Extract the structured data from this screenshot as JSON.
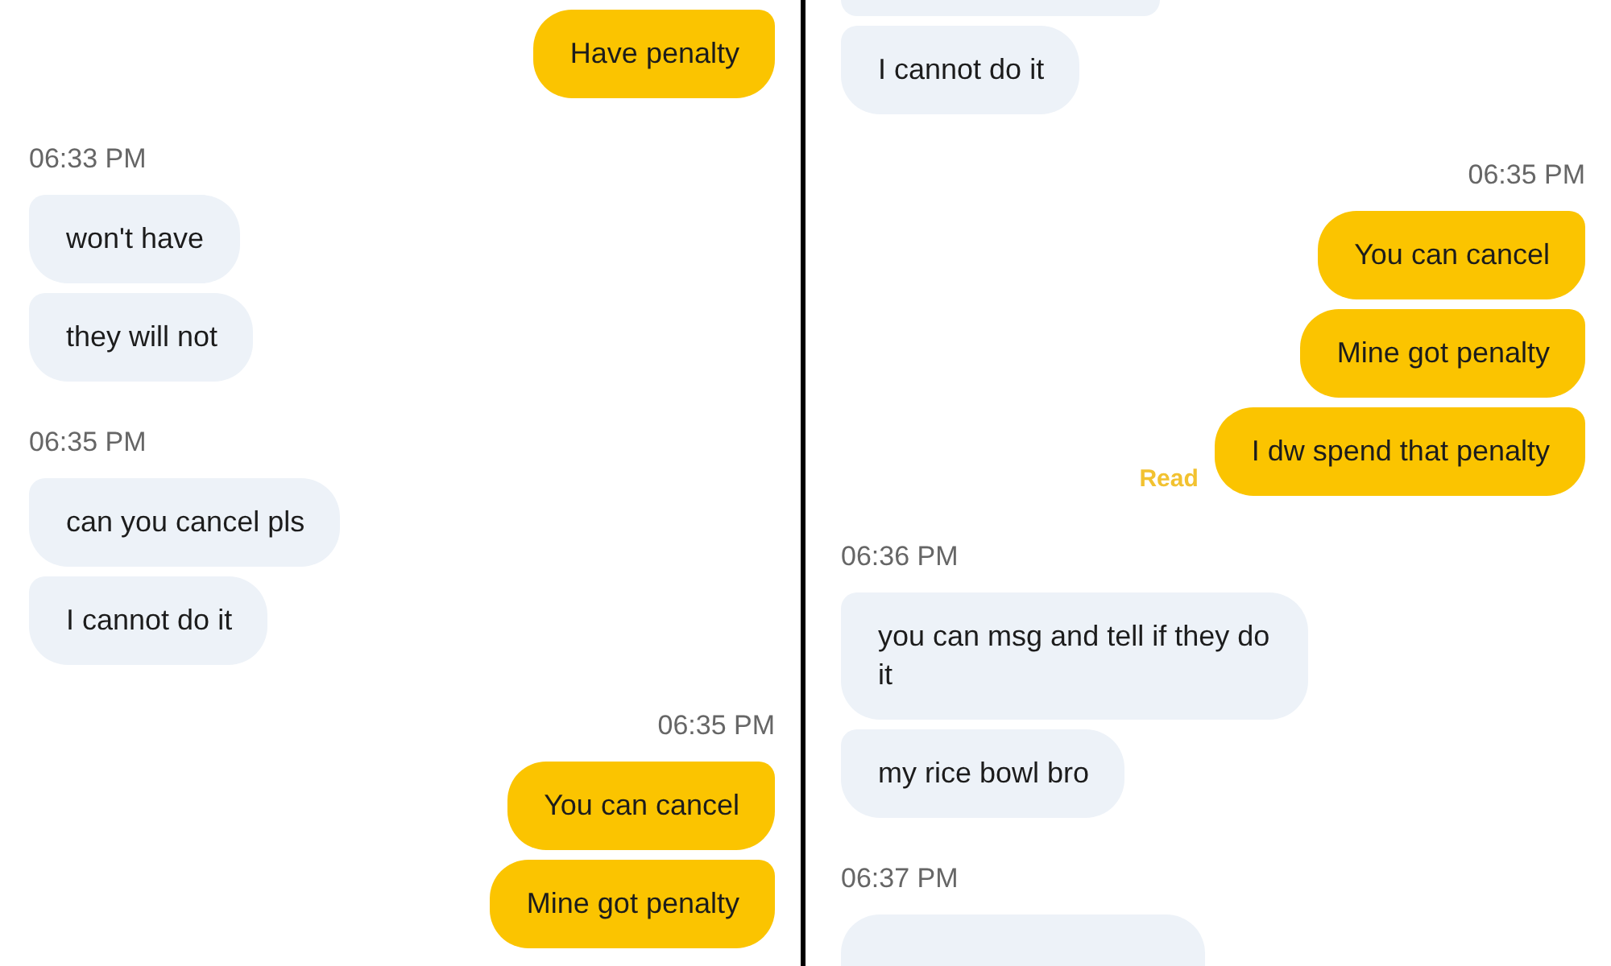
{
  "panels": [
    {
      "items": [
        {
          "kind": "out",
          "text": "Have penalty"
        },
        {
          "kind": "time-left",
          "text": "06:33 PM"
        },
        {
          "kind": "in",
          "text": "won't have"
        },
        {
          "kind": "in",
          "text": "they will not"
        },
        {
          "kind": "time-left",
          "text": "06:35 PM"
        },
        {
          "kind": "in",
          "text": "can you cancel pls"
        },
        {
          "kind": "in",
          "text": "I cannot do it"
        },
        {
          "kind": "time-right",
          "text": "06:35 PM"
        },
        {
          "kind": "out",
          "text": "You can cancel"
        },
        {
          "kind": "out",
          "text": "Mine got penalty"
        }
      ]
    },
    {
      "items": [
        {
          "kind": "in-cut-top"
        },
        {
          "kind": "in",
          "text": "I cannot do it"
        },
        {
          "kind": "time-right",
          "text": "06:35 PM"
        },
        {
          "kind": "out",
          "text": "You can cancel"
        },
        {
          "kind": "out",
          "text": "Mine got penalty"
        },
        {
          "kind": "out",
          "text": "I dw spend that penalty",
          "status": "Read"
        },
        {
          "kind": "time-left",
          "text": "06:36 PM"
        },
        {
          "kind": "in",
          "text": "you can msg and tell if they do it"
        },
        {
          "kind": "in",
          "text": "my rice bowl bro"
        },
        {
          "kind": "time-left",
          "text": "06:37 PM"
        },
        {
          "kind": "in-cut-bottom"
        }
      ]
    }
  ]
}
